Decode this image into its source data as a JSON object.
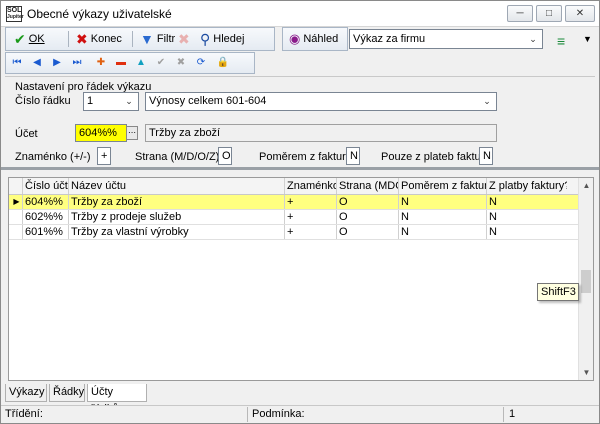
{
  "window": {
    "title": "Obecné výkazy uživatelské",
    "app_icon_text": [
      "SOL",
      "Jupiter"
    ]
  },
  "toolbar": {
    "ok_label": "OK",
    "konec_label": "Konec",
    "filtr_label": "Filtr",
    "hledej_label": "Hledej",
    "nahled_label": "Náhled",
    "report_combo_value": "Výkaz za firmu"
  },
  "settings": {
    "section_title": "Nastavení pro řádek výkazu",
    "cislo_radku_label": "Číslo řádku",
    "cislo_radku_value": "1",
    "radek_name_value": "Výnosy celkem 601-604",
    "ucet_label": "Účet",
    "ucet_value": "604%%",
    "ucet_name_value": "Tržby za zboží",
    "znamenko_label": "Znaménko (+/-)",
    "znamenko_value": "+",
    "strana_label": "Strana (M/D/O/Z)",
    "strana_value": "O",
    "pomerem_label": "Poměrem z faktur",
    "pomerem_value": "N",
    "pouze_label": "Pouze z plateb faktur",
    "pouze_value": "N"
  },
  "grid": {
    "columns": [
      "Číslo účtu",
      "Název účtu",
      "Znaménko",
      "Strana (MDO)",
      "Poměrem z faktury?",
      "Z platby faktury?"
    ],
    "rows": [
      {
        "ucet": "604%%",
        "nazev": "Tržby za zboží",
        "znamenko": "+",
        "strana": "O",
        "pomerem": "N",
        "platby": "N",
        "selected": true
      },
      {
        "ucet": "602%%",
        "nazev": "Tržby z prodeje služeb",
        "znamenko": "+",
        "strana": "O",
        "pomerem": "N",
        "platby": "N",
        "selected": false
      },
      {
        "ucet": "601%%",
        "nazev": "Tržby za vlastní výrobky",
        "znamenko": "+",
        "strana": "O",
        "pomerem": "N",
        "platby": "N",
        "selected": false
      }
    ]
  },
  "tooltip": "ShiftF3",
  "tabs": [
    "Výkazy",
    "Řádky",
    "Účty řádků"
  ],
  "status": {
    "trideni_label": "Třídění:",
    "podminka_label": "Podmínka:",
    "count": "1"
  },
  "colors": {
    "selected_row": "#ffff80",
    "ucet_field": "#ffff00",
    "ok_icon": "#1a9a1a",
    "konec_icon": "#d01010",
    "filter_icon": "#2a6ad0",
    "nahled_icon": "#8a1a8a",
    "nav_icon": "#1a5ad0"
  }
}
